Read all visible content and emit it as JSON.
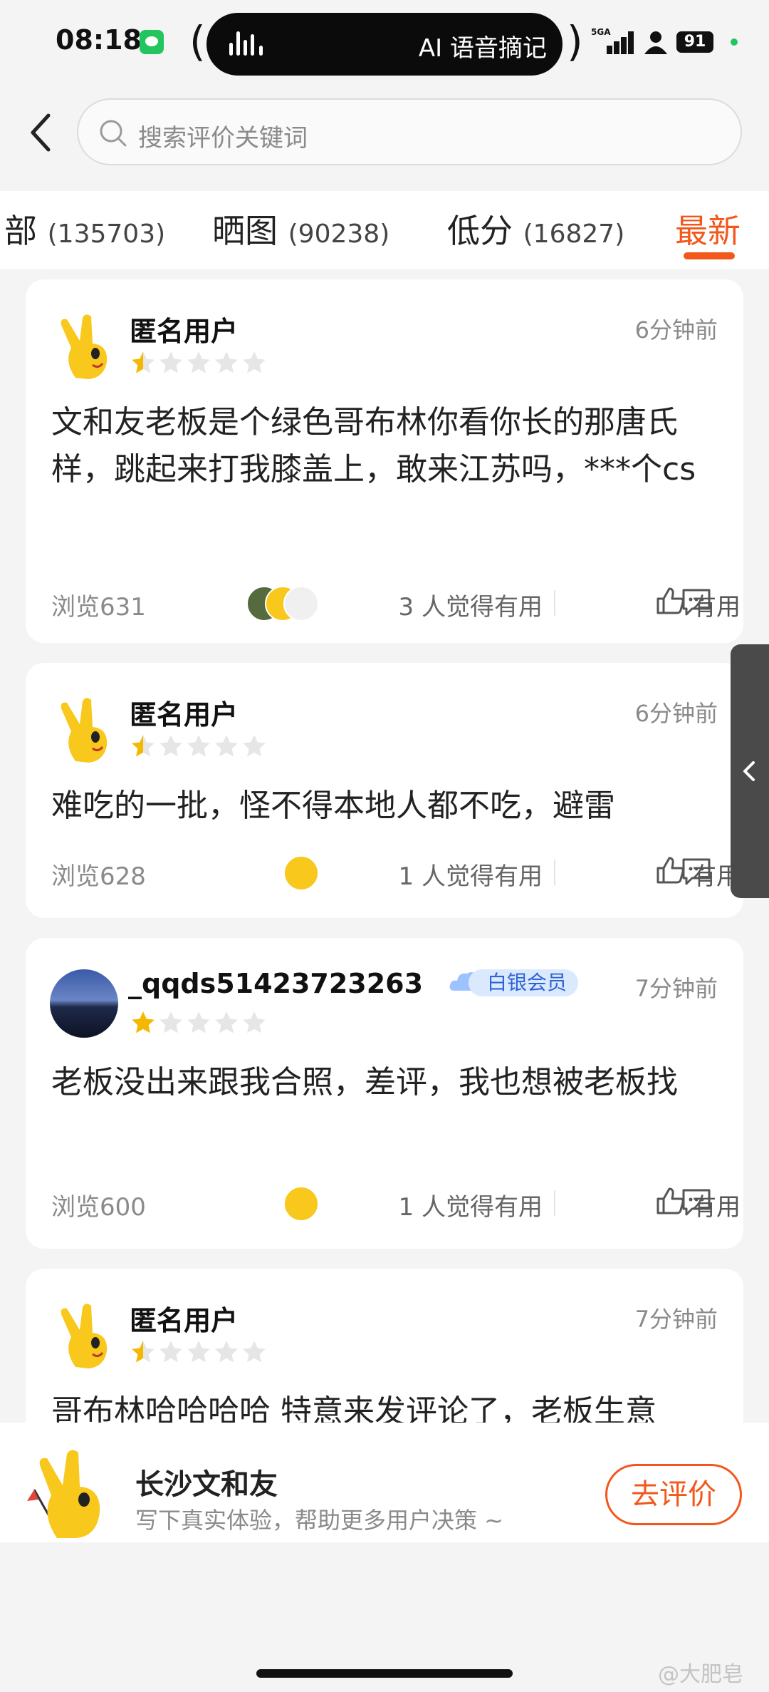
{
  "status_bar": {
    "time": "08:18",
    "island_text": "AI 语音摘记",
    "signal_label": "5GA",
    "battery": "91"
  },
  "search": {
    "placeholder": "搜索评价关键词"
  },
  "tabs": [
    {
      "label": "部",
      "count": "(135703)"
    },
    {
      "label": "晒图",
      "count": "(90238)"
    },
    {
      "label": "低分",
      "count": "(16827)"
    },
    {
      "label": "最新",
      "count": ""
    }
  ],
  "reviews": [
    {
      "user": "匿名用户",
      "time": "6分钟前",
      "rating": 0.5,
      "text": "文和友老板是个绿色哥布林你看你长的那唐氏样，跳起来打我膝盖上，敢来江苏吗，***个cs",
      "views": "浏览631",
      "helpful": "3 人觉得有用",
      "useful_label": "有用"
    },
    {
      "user": "匿名用户",
      "time": "6分钟前",
      "rating": 0.5,
      "text": "难吃的一批，怪不得本地人都不吃，避雷",
      "views": "浏览628",
      "helpful": "1 人觉得有用",
      "useful_label": "有用"
    },
    {
      "user": "_qqds51423723263",
      "badge": "白银会员",
      "time": "7分钟前",
      "rating": 1,
      "text": "老板没出来跟我合照，差评，我也想被老板找",
      "views": "浏览600",
      "helpful": "1 人觉得有用",
      "useful_label": "有用"
    },
    {
      "user": "匿名用户",
      "time": "7分钟前",
      "rating": 0.5,
      "text": "哥布林哈哈哈哈 特意来发评论了，老板生意"
    }
  ],
  "bottom": {
    "shop_name": "长沙文和友",
    "hint": "写下真实体验，帮助更多用户决策 ~",
    "button": "去评价"
  },
  "watermark": "@大肥皂",
  "colors": {
    "accent": "#f2581b",
    "star": "#f5b800",
    "badge_bg": "#dbe9ff",
    "badge_text": "#2c63d6"
  }
}
